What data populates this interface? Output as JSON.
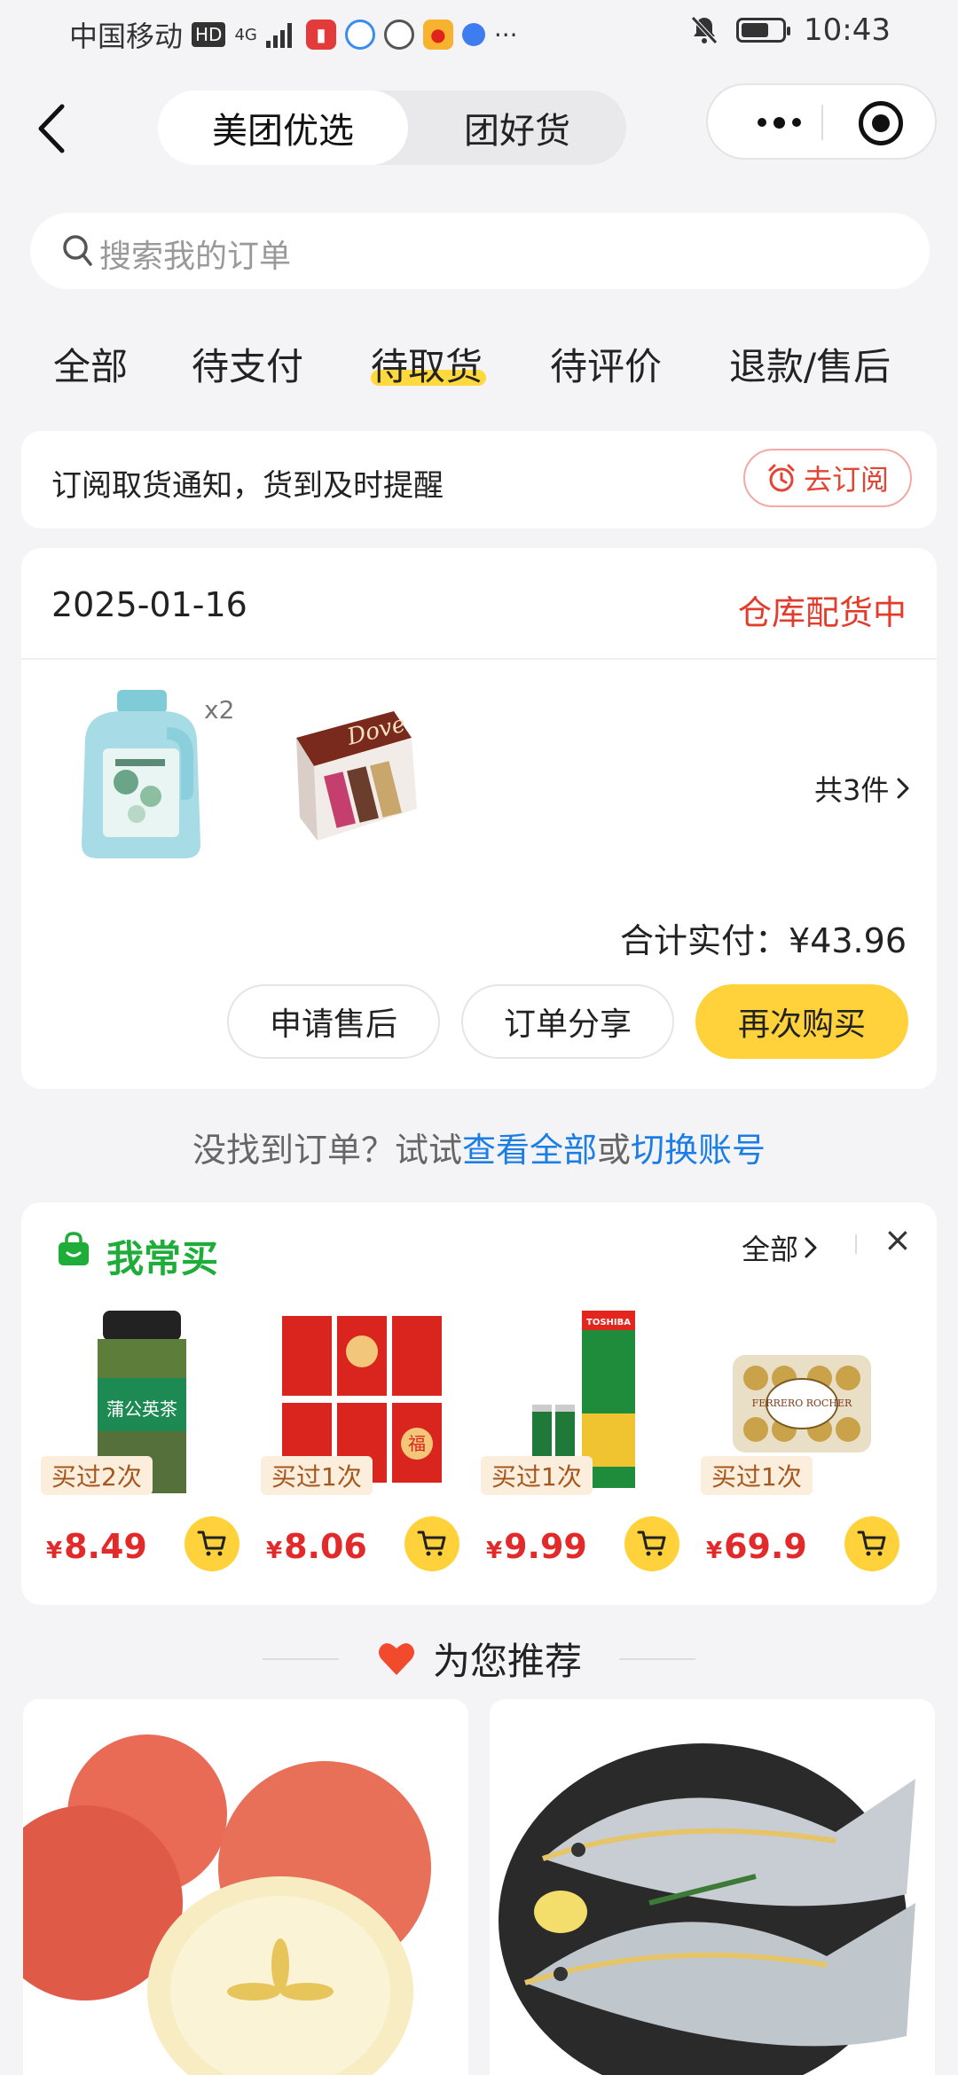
{
  "status_bar": {
    "carrier": "中国移动",
    "hd": "HD",
    "network": "4G",
    "more": "···",
    "time": "10:43"
  },
  "header": {
    "tabs": [
      "美团优选",
      "团好货"
    ],
    "active_tab": 0
  },
  "search": {
    "placeholder": "搜索我的订单"
  },
  "order_tabs": {
    "items": [
      "全部",
      "待支付",
      "待取货",
      "待评价",
      "退款/售后"
    ],
    "active": 2,
    "accent": "#ffd93d"
  },
  "notice": {
    "text": "订阅取货通知，货到及时提醒",
    "button": "去订阅"
  },
  "order": {
    "date": "2025-01-16",
    "status": "仓库配货中",
    "items": [
      {
        "icon": "laundry-detergent-bottle",
        "qty": "x2"
      },
      {
        "icon": "dove-chocolate-box",
        "qty": ""
      }
    ],
    "count": "共3件",
    "total_label": "合计实付：",
    "total_value": "¥43.96",
    "buttons": [
      "申请售后",
      "订单分享",
      "再次购买"
    ]
  },
  "not_found": {
    "prefix": "没找到订单？试试",
    "link1": "查看全部",
    "mid": "或",
    "link2": "切换账号"
  },
  "frequent": {
    "title": "我常买",
    "all": "全部",
    "items": [
      {
        "badge": "买过2次",
        "currency": "¥",
        "price": "8.49",
        "label": "蒲公英茶"
      },
      {
        "badge": "买过1次",
        "currency": "¥",
        "price": "8.06",
        "label": "福"
      },
      {
        "badge": "买过1次",
        "currency": "¥",
        "price": "9.99",
        "label": "TOSHIBA"
      },
      {
        "badge": "买过1次",
        "currency": "¥",
        "price": "69.9",
        "label": "FERRERO ROCHER"
      }
    ]
  },
  "recommend": {
    "title": "为您推荐",
    "items": [
      {
        "icon": "apples"
      },
      {
        "icon": "pomfret-fish"
      }
    ]
  },
  "colors": {
    "accent_yellow": "#ffd23c",
    "status_red": "#e23c2c",
    "link_blue": "#1a7ee6",
    "green": "#1fad3a"
  }
}
